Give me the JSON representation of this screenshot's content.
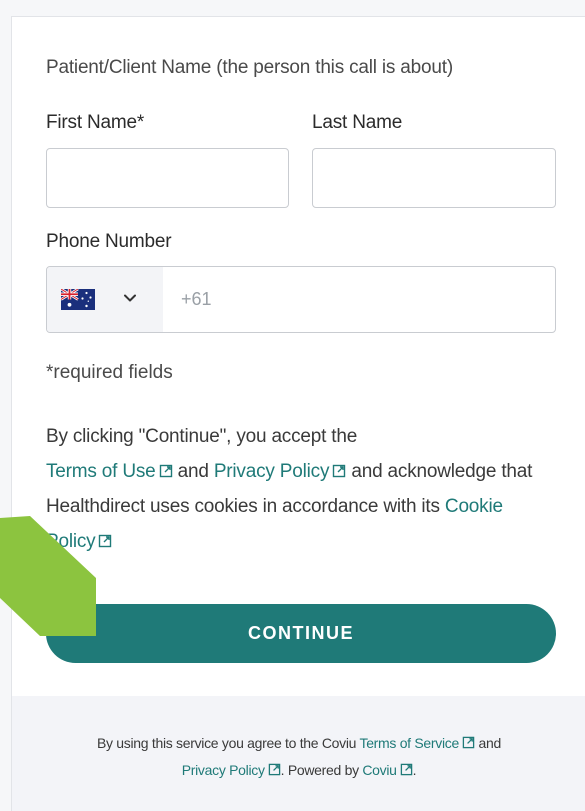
{
  "form": {
    "section_label": "Patient/Client Name (the person this call is about)",
    "first_name_label": "First Name*",
    "first_name_value": "",
    "last_name_label": "Last Name",
    "last_name_value": "",
    "phone_label": "Phone Number",
    "phone_country": "Australia",
    "phone_placeholder": "+61",
    "phone_value": "",
    "required_note": "*required fields"
  },
  "consent": {
    "text_before": "By clicking \"Continue\", you accept the",
    "terms_link": "Terms of Use",
    "and_1": "and",
    "privacy_link": "Privacy Policy",
    "text_middle": "and acknowledge that Healthdirect uses cookies in accordance with its",
    "cookie_link": "Cookie Policy"
  },
  "actions": {
    "continue_label": "CONTINUE"
  },
  "footer": {
    "text_before": "By using this service you agree to the Coviu",
    "terms_link": "Terms of Service",
    "and": "and",
    "privacy_link": "Privacy Policy",
    "powered_by": ". Powered by",
    "coviu_link": "Coviu",
    "end": "."
  },
  "colors": {
    "accent": "#1f7a78",
    "arrow": "#8cc43f"
  }
}
